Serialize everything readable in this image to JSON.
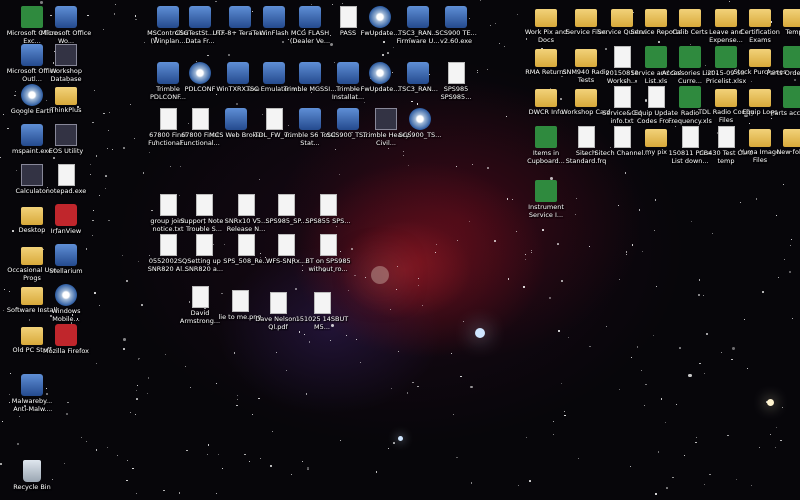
{
  "desktop": {
    "icons": [
      {
        "label": "Microsoft Office Exc...",
        "icon": "excel-icon"
      },
      {
        "label": "Microsoft Office Wo...",
        "icon": "word-icon"
      },
      {
        "label": "MSController (Winplan...",
        "icon": "app-icon"
      },
      {
        "label": "CSGTestSt... RX Data Fr...",
        "icon": "app-icon"
      },
      {
        "label": "UTF-8+ TeraTer...",
        "icon": "app-icon"
      },
      {
        "label": "WinFlash",
        "icon": "app-icon"
      },
      {
        "label": "MCG FLASH (Dealer Ve...",
        "icon": "app-icon"
      },
      {
        "label": "PASS",
        "icon": "document-icon"
      },
      {
        "label": "FwUpdate...",
        "icon": "disc-icon"
      },
      {
        "label": "TSC3_RAN... Firmware U...",
        "icon": "app-icon"
      },
      {
        "label": "SCS900 TE... v2.60.exe",
        "icon": "app-icon"
      },
      {
        "label": "Microsoft Office Outl...",
        "icon": "outlook-icon"
      },
      {
        "label": "Workshop Database",
        "icon": "database-icon"
      },
      {
        "label": "Trimble PDLCONF...",
        "icon": "pdl-icon"
      },
      {
        "label": "PDLCONF",
        "icon": "disc-icon"
      },
      {
        "label": "WinTXRX.exe",
        "icon": "app-icon"
      },
      {
        "label": "TSC Emulator v...",
        "icon": "app-icon"
      },
      {
        "label": "Trimble MGSSI...",
        "icon": "app-icon"
      },
      {
        "label": "Trimble Installat...",
        "icon": "app-icon"
      },
      {
        "label": "FwUpdate...",
        "icon": "disc-icon"
      },
      {
        "label": "TSC3_RAN...",
        "icon": "app-icon"
      },
      {
        "label": "SPS985 SPS985...",
        "icon": "document-icon"
      },
      {
        "label": "Google Earth",
        "icon": "globe-icon"
      },
      {
        "label": "ThinkPlus",
        "icon": "folder-icon"
      },
      {
        "label": "67800 Final Functional...",
        "icon": "document-icon"
      },
      {
        "label": "67800 Final Functional...",
        "icon": "document-icon"
      },
      {
        "label": "MCS Web Broker",
        "icon": "app-icon"
      },
      {
        "label": "TDL_FW_v...",
        "icon": "document-icon"
      },
      {
        "label": "Trimble S6 Total Stat...",
        "icon": "app-icon"
      },
      {
        "label": "SCS900_TS...",
        "icon": "app-icon"
      },
      {
        "label": "Trimble Heavy Civil...",
        "icon": "calculator-icon"
      },
      {
        "label": "SCS900_TS...",
        "icon": "disc-icon"
      },
      {
        "label": "mspaint.exe",
        "icon": "paint-icon"
      },
      {
        "label": "EOS Utility",
        "icon": "camera-icon"
      },
      {
        "label": "Calculator",
        "icon": "calculator-icon"
      },
      {
        "label": "notepad.exe",
        "icon": "notepad-icon"
      },
      {
        "label": "Desktop",
        "icon": "folder-icon"
      },
      {
        "label": "IrfanView",
        "icon": "irfanview-icon"
      },
      {
        "label": "Occasional Use Progs",
        "icon": "folder-icon"
      },
      {
        "label": "Stellarium",
        "icon": "app-icon"
      },
      {
        "label": "Software Install",
        "icon": "folder-icon"
      },
      {
        "label": "Windows Mobile...",
        "icon": "globe-icon"
      },
      {
        "label": "Old PC Stuff",
        "icon": "folder-icon"
      },
      {
        "label": "Mozilla Firefox",
        "icon": "firefox-icon"
      },
      {
        "label": "Malwareby... Anti-Malw...",
        "icon": "app-icon"
      },
      {
        "label": "Recycle Bin",
        "icon": "recycle-bin-icon"
      },
      {
        "label": "group joint notice.txt",
        "icon": "document-icon"
      },
      {
        "label": "Support Note - Trouble S...",
        "icon": "document-icon"
      },
      {
        "label": "SNRx10 V5... Release N...",
        "icon": "document-icon"
      },
      {
        "label": "SPS985_SP...",
        "icon": "document-icon"
      },
      {
        "label": "SPS855 SPS...",
        "icon": "document-icon"
      },
      {
        "label": "0552002SQ SNR820 Al...",
        "icon": "document-icon"
      },
      {
        "label": "Setting up SNR820 a...",
        "icon": "document-icon"
      },
      {
        "label": "SPS_508_Re...",
        "icon": "document-icon"
      },
      {
        "label": "WFS-SNRx...",
        "icon": "document-icon"
      },
      {
        "label": "BT on SPS985 without ro...",
        "icon": "document-icon"
      },
      {
        "label": "David Armstrong...",
        "icon": "document-icon"
      },
      {
        "label": "lie to me.png",
        "icon": "image-icon"
      },
      {
        "label": "Dave Nelson - Ql.pdf",
        "icon": "pdf-icon"
      },
      {
        "label": "151025 14SBUT M5...",
        "icon": "document-icon"
      },
      {
        "label": "Work Pix and Docs",
        "icon": "folder-icon"
      },
      {
        "label": "Service Files",
        "icon": "folder-icon"
      },
      {
        "label": "Service Quotes",
        "icon": "folder-icon"
      },
      {
        "label": "Service Reports",
        "icon": "folder-icon"
      },
      {
        "label": "Calib Certs",
        "icon": "folder-icon"
      },
      {
        "label": "Leave and Expense...",
        "icon": "folder-icon"
      },
      {
        "label": "Certification Exams",
        "icon": "folder-icon"
      },
      {
        "label": "Temp",
        "icon": "folder-icon"
      },
      {
        "label": "RMA Returns",
        "icon": "folder-icon"
      },
      {
        "label": "SNM940 Radio Tests",
        "icon": "folder-icon"
      },
      {
        "label": "20150818 Worksh...",
        "icon": "document-icon"
      },
      {
        "label": "Service and Cal List.xls",
        "icon": "spreadsheet-icon"
      },
      {
        "label": "Accessories List - Curre...",
        "icon": "spreadsheet-icon"
      },
      {
        "label": "2015-09 SS Pricelist.xlsx",
        "icon": "spreadsheet-icon"
      },
      {
        "label": "Stock Purchases",
        "icon": "folder-icon"
      },
      {
        "label": "Parts Orders.xlsx",
        "icon": "spreadsheet-icon"
      },
      {
        "label": "DWCR Info",
        "icon": "folder-icon"
      },
      {
        "label": "Workshop Card",
        "icon": "folder-icon"
      },
      {
        "label": "Service&Cal info.txt",
        "icon": "document-icon"
      },
      {
        "label": "Equip Update Codes Fro...",
        "icon": "document-icon"
      },
      {
        "label": "Radio Frequency.xls",
        "icon": "spreadsheet-icon"
      },
      {
        "label": "TDL Radio Config Files",
        "icon": "folder-icon"
      },
      {
        "label": "Equip Logs",
        "icon": "folder-icon"
      },
      {
        "label": "Parts access...",
        "icon": "spreadsheet-icon"
      },
      {
        "label": "Items in Cupboard...",
        "icon": "spreadsheet-icon"
      },
      {
        "label": "Sitech Standard.frq",
        "icon": "document-icon"
      },
      {
        "label": "Sitech Channel...",
        "icon": "document-icon"
      },
      {
        "label": "my pix",
        "icon": "folder-icon"
      },
      {
        "label": "150811 Price List down...",
        "icon": "document-icon"
      },
      {
        "label": "CB430 Test Card temp",
        "icon": "document-icon"
      },
      {
        "label": "Yuma Image Files",
        "icon": "folder-icon"
      },
      {
        "label": "New folder",
        "icon": "folder-icon"
      },
      {
        "label": "Instrument Service I...",
        "icon": "spreadsheet-icon"
      }
    ]
  }
}
